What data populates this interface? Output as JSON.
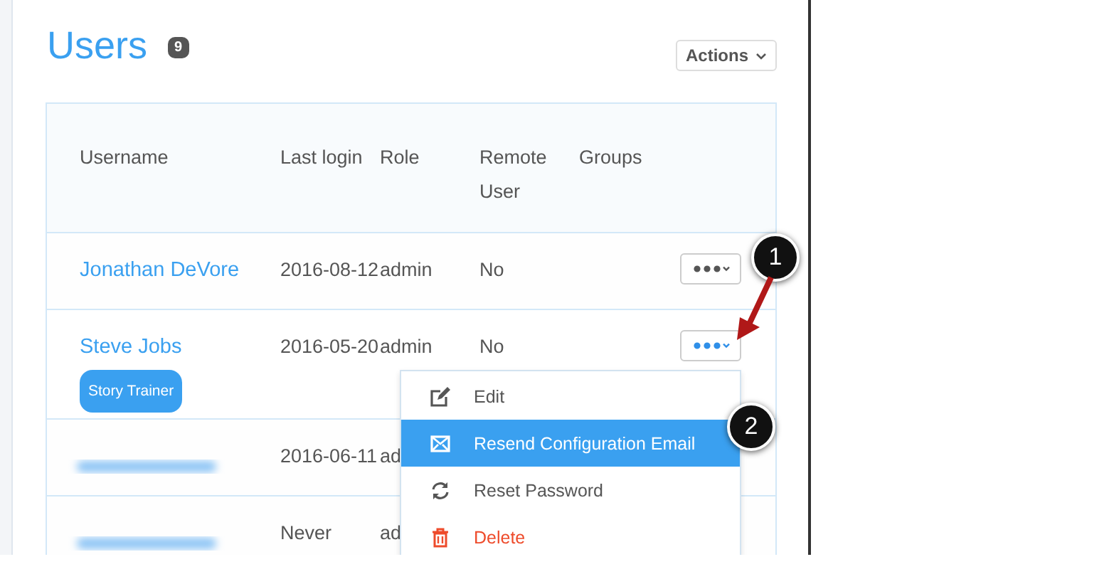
{
  "page": {
    "title": "Users",
    "count": "9",
    "actions_button": "Actions"
  },
  "table": {
    "columns": [
      "Username",
      "Last login",
      "Role",
      "Remote User",
      "Groups"
    ],
    "rows": [
      {
        "name": "Jonathan DeVore",
        "last_login": "2016-08-12",
        "role": "admin",
        "remote_user": "No",
        "menu_open": false
      },
      {
        "name": "Steve Jobs",
        "tag": "Story Trainer",
        "last_login": "2016-05-20",
        "role": "admin",
        "remote_user": "No",
        "menu_open": true
      },
      {
        "last_login": "2016-06-11",
        "role": "ad",
        "menu_open": false
      },
      {
        "last_login": "Never",
        "role": "ad",
        "menu_open": false
      }
    ]
  },
  "row_menu": [
    {
      "kind": "edit",
      "label": "Edit",
      "selected": false
    },
    {
      "kind": "email",
      "label": "Resend Configuration Email",
      "selected": true
    },
    {
      "kind": "refresh",
      "label": "Reset Password",
      "selected": false
    },
    {
      "kind": "delete",
      "label": "Delete",
      "selected": false
    }
  ],
  "callouts": [
    {
      "label": "1"
    },
    {
      "label": "2"
    }
  ]
}
